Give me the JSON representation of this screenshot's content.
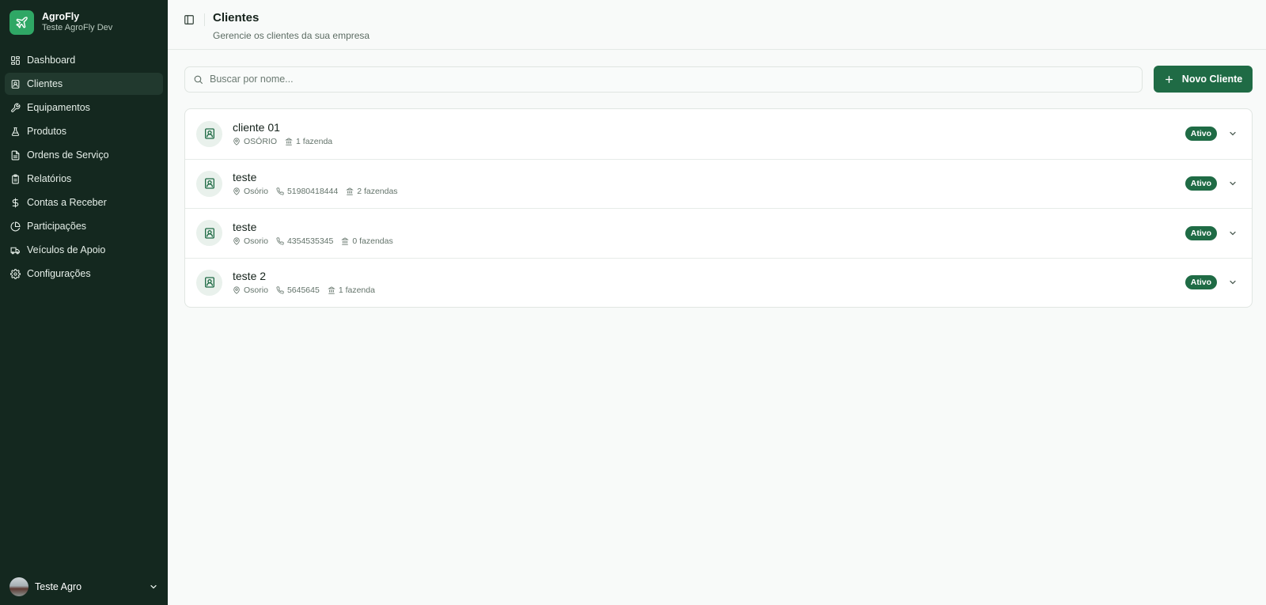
{
  "brand": {
    "name": "AgroFly",
    "subtitle": "Teste AgroFly Dev"
  },
  "sidebar": {
    "items": [
      {
        "label": "Dashboard",
        "icon": "dashboard-grid-icon"
      },
      {
        "label": "Clientes",
        "icon": "contact-icon",
        "active": true
      },
      {
        "label": "Equipamentos",
        "icon": "wrench-icon"
      },
      {
        "label": "Produtos",
        "icon": "flask-icon"
      },
      {
        "label": "Ordens de Serviço",
        "icon": "document-icon"
      },
      {
        "label": "Relatórios",
        "icon": "clipboard-icon"
      },
      {
        "label": "Contas a Receber",
        "icon": "dollar-icon"
      },
      {
        "label": "Participações",
        "icon": "pie-chart-icon"
      },
      {
        "label": "Veículos de Apoio",
        "icon": "truck-icon"
      },
      {
        "label": "Configurações",
        "icon": "gear-icon"
      }
    ]
  },
  "user": {
    "name": "Teste Agro"
  },
  "header": {
    "title": "Clientes",
    "subtitle": "Gerencie os clientes da sua empresa"
  },
  "search": {
    "placeholder": "Buscar por nome...",
    "value": ""
  },
  "toolbar": {
    "new_label": "Novo Cliente"
  },
  "clients": [
    {
      "name": "cliente 01",
      "city": "OSÓRIO",
      "phone": "",
      "farms": "1 fazenda",
      "status": "Ativo"
    },
    {
      "name": "teste",
      "city": "Osório",
      "phone": "51980418444",
      "farms": "2 fazendas",
      "status": "Ativo"
    },
    {
      "name": "teste",
      "city": "Osorio",
      "phone": "4354535345",
      "farms": "0 fazendas",
      "status": "Ativo"
    },
    {
      "name": "teste 2",
      "city": "Osorio",
      "phone": "5645645",
      "farms": "1 fazenda",
      "status": "Ativo"
    }
  ],
  "colors": {
    "sidebar_bg": "#14281f",
    "accent": "#1f6b45",
    "brand_logo": "#2fa765"
  }
}
